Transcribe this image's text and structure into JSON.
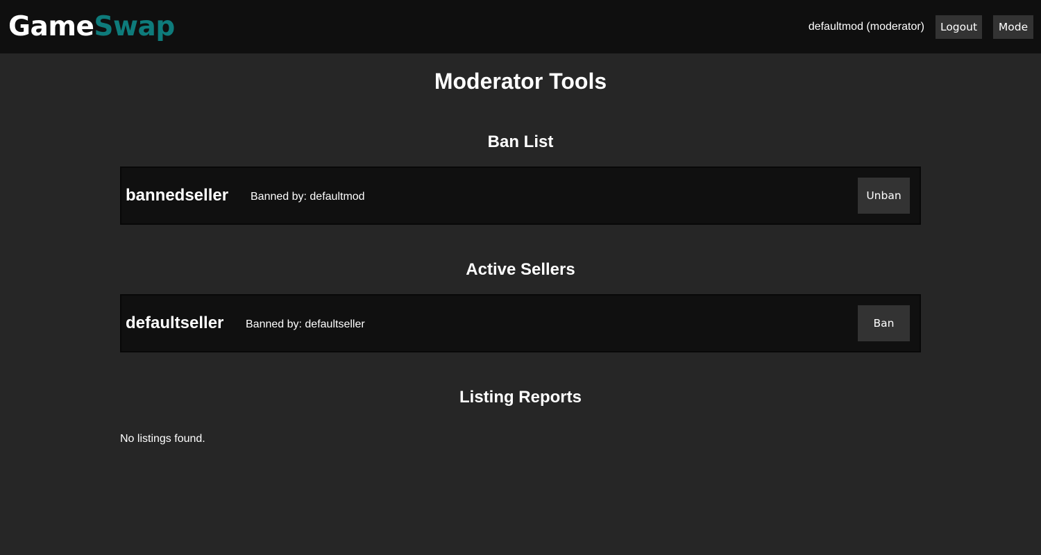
{
  "header": {
    "logo_part1": "Game",
    "logo_part2": "Swap",
    "user_info": "defaultmod (moderator)",
    "logout_label": "Logout",
    "mode_label": "Mode"
  },
  "page": {
    "title": "Moderator Tools"
  },
  "ban_list": {
    "title": "Ban List",
    "items": [
      {
        "username": "bannedseller",
        "meta": "Banned by: defaultmod",
        "action_label": "Unban"
      }
    ]
  },
  "active_sellers": {
    "title": "Active Sellers",
    "items": [
      {
        "username": "defaultseller",
        "meta": "Banned by: defaultseller",
        "action_label": "Ban"
      }
    ]
  },
  "listing_reports": {
    "title": "Listing Reports",
    "empty_message": "No listings found."
  },
  "colors": {
    "background": "#262626",
    "header_bg": "#0f0f0f",
    "card_bg": "#101010",
    "button_bg": "#333333",
    "brand_accent": "#0e7b7b",
    "text": "#ffffff"
  }
}
